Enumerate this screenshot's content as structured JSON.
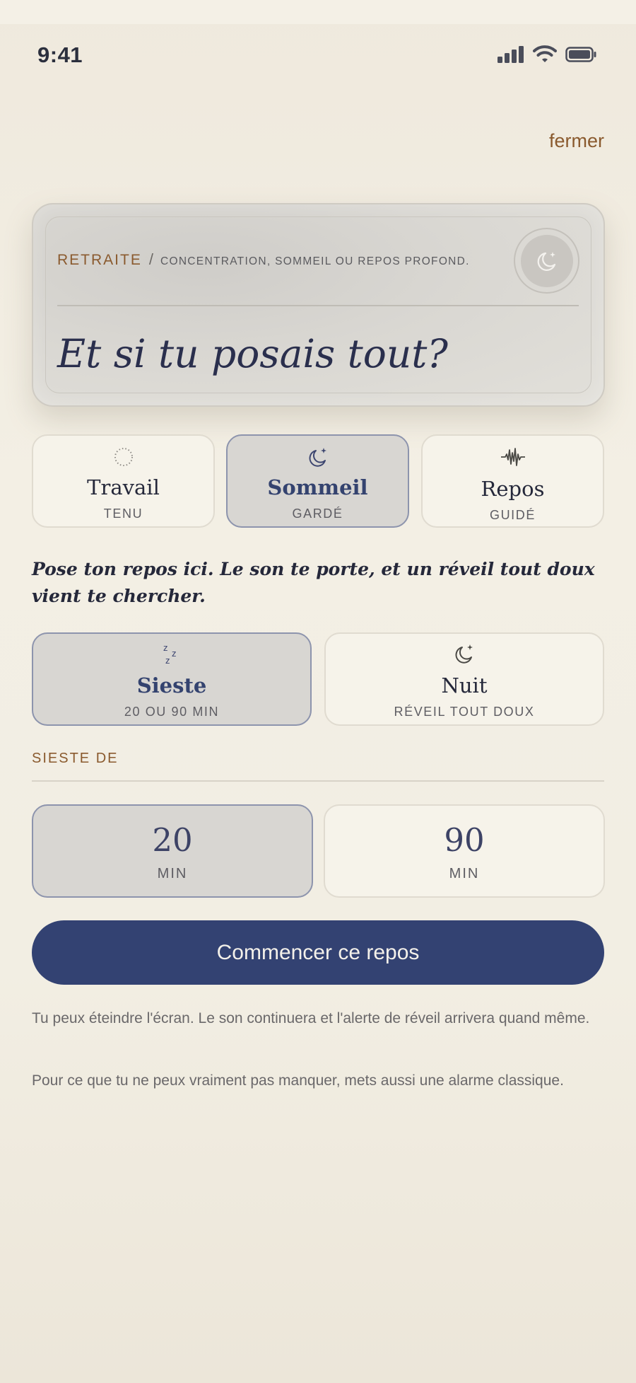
{
  "status_bar": {
    "time": "9:41"
  },
  "header": {
    "close_label": "fermer"
  },
  "hero": {
    "kicker": "RETRAITE",
    "separator": "/",
    "kicker_sub": "CONCENTRATION, SOMMEIL OU REPOS PROFOND.",
    "title": "Et si tu posais tout?",
    "icon": "moon-stars-icon"
  },
  "modes": [
    {
      "label": "Travail",
      "sub": "TENU",
      "icon": "dotted-circle-icon",
      "selected": false
    },
    {
      "label": "Sommeil",
      "sub": "GARDÉ",
      "icon": "moon-stars-icon",
      "selected": true
    },
    {
      "label": "Repos",
      "sub": "GUIDÉ",
      "icon": "waveform-icon",
      "selected": false
    }
  ],
  "description": "Pose ton repos ici. Le son te porte, et un réveil tout doux vient te chercher.",
  "rest_types": [
    {
      "label": "Sieste",
      "sub": "20 OU 90 MIN",
      "icon": "zzz-icon",
      "selected": true
    },
    {
      "label": "Nuit",
      "sub": "RÉVEIL TOUT DOUX",
      "icon": "moon-stars-icon",
      "selected": false
    }
  ],
  "duration": {
    "section_label": "SIESTE DE",
    "options": [
      {
        "value": "20",
        "unit": "MIN",
        "selected": true
      },
      {
        "value": "90",
        "unit": "MIN",
        "selected": false
      }
    ]
  },
  "cta": {
    "label": "Commencer ce repos"
  },
  "notes": [
    "Tu peux éteindre l'écran. Le son continuera et l'alerte de réveil arrivera quand même.",
    "Pour ce que tu ne peux vraiment pas manquer, mets aussi une alarme classique."
  ],
  "colors": {
    "accent": "#334272",
    "brand_brown": "#8a5a2e",
    "selected_bg": "#d8d6d2",
    "card_bg": "#f6f3ea"
  }
}
